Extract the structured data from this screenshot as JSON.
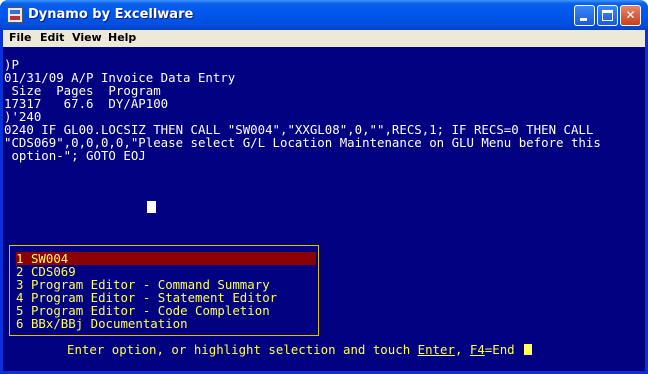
{
  "window": {
    "title": "Dynamo by Excellware"
  },
  "menubar": {
    "items": [
      "File",
      "Edit",
      "View",
      "Help"
    ]
  },
  "console": {
    "lines": [
      ")P",
      "01/31/09 A/P Invoice Data Entry",
      " Size  Pages  Program",
      "17317   67.6  DY/AP100",
      ")'240",
      "0240 IF GL00.LOCSIZ THEN CALL \"SW004\",\"XXGL08\",0,\"\",RECS,1; IF RECS=0 THEN CALL",
      "\"CDS069\",0,0,0,0,\"Please select G/L Location Maintenance on GLU Menu before this",
      " option-\"; GOTO EOJ"
    ]
  },
  "options": [
    {
      "num": "1",
      "label": "SW004",
      "selected": true
    },
    {
      "num": "2",
      "label": "CDS069",
      "selected": false
    },
    {
      "num": "3",
      "label": "Program Editor - Command Summary",
      "selected": false
    },
    {
      "num": "4",
      "label": "Program Editor - Statement Editor",
      "selected": false
    },
    {
      "num": "5",
      "label": "Program Editor - Code Completion",
      "selected": false
    },
    {
      "num": "6",
      "label": "BBx/BBj Documentation",
      "selected": false
    }
  ],
  "prompt": {
    "before": "Enter option, or highlight selection and touch ",
    "enter": "Enter",
    "mid": ", ",
    "f4": "F4",
    "after": "=End "
  },
  "colors": {
    "console_bg": "#000080",
    "menu_text": "#ffff55",
    "selection_bg": "#8b0000"
  }
}
